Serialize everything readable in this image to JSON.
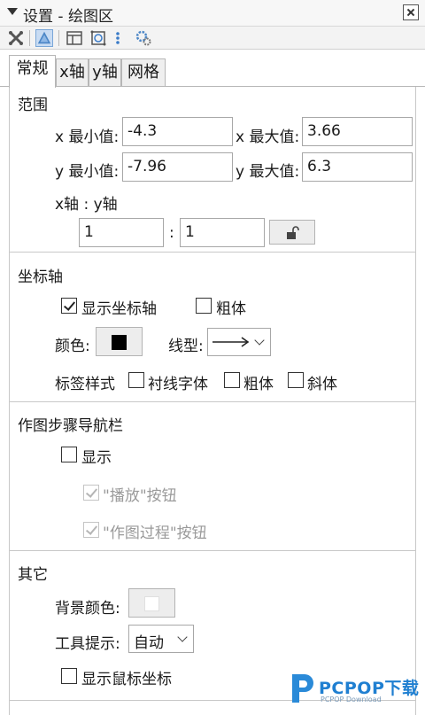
{
  "window": {
    "title": "设置 - 绘图区"
  },
  "tabs": [
    {
      "label": "常规",
      "active": true
    },
    {
      "label": "x轴",
      "active": false
    },
    {
      "label": "y轴",
      "active": false
    },
    {
      "label": "网格",
      "active": false
    }
  ],
  "range": {
    "heading": "范围",
    "xmin_label": "x 最小值:",
    "xmin_value": "-4.3",
    "xmax_label": "x 最大值:",
    "xmax_value": "3.66",
    "ymin_label": "y 最小值:",
    "ymin_value": "-7.96",
    "ymax_label": "y 最大值:",
    "ymax_value": "6.3",
    "ratio_label": "x轴 : y轴",
    "ratio_x": "1",
    "ratio_sep": ":",
    "ratio_y": "1"
  },
  "axes": {
    "heading": "坐标轴",
    "show_axes_label": "显示坐标轴",
    "show_axes_checked": true,
    "bold_label": "粗体",
    "bold_checked": false,
    "color_label": "颜色:",
    "color_value": "#000000",
    "line_style_label": "线型:",
    "label_style_label": "标签样式",
    "serif_label": "衬线字体",
    "label_bold_label": "粗体",
    "italic_label": "斜体"
  },
  "nav": {
    "heading": "作图步骤导航栏",
    "show_label": "显示",
    "show_checked": false,
    "play_label": "\"播放\"按钮",
    "play_checked": true,
    "process_label": "\"作图过程\"按钮",
    "process_checked": true
  },
  "other": {
    "heading": "其它",
    "bg_color_label": "背景颜色:",
    "bg_color_value": "#ffffff",
    "tooltip_label": "工具提示:",
    "tooltip_value": "自动",
    "show_mouse_coords_label": "显示鼠标坐标",
    "show_mouse_coords_checked": false
  },
  "watermark": {
    "text": "PCPOP下载",
    "sub": "PCPOP Download"
  }
}
